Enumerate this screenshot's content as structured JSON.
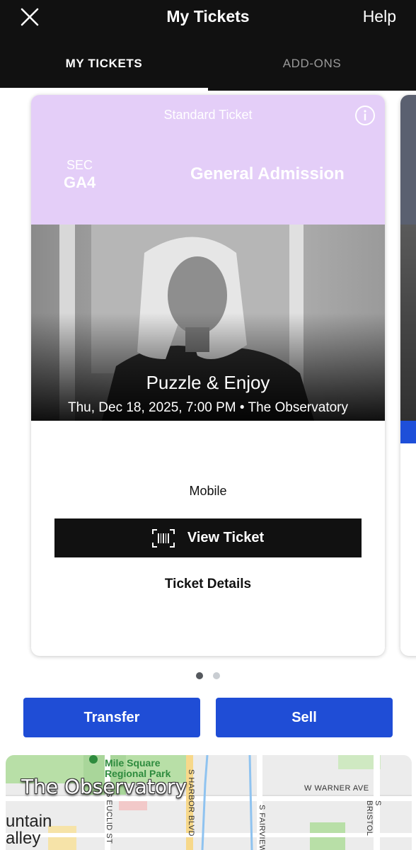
{
  "header": {
    "title": "My Tickets",
    "help_label": "Help"
  },
  "tabs": [
    {
      "label": "MY TICKETS",
      "active": true
    },
    {
      "label": "ADD-ONS",
      "active": false
    }
  ],
  "ticket": {
    "type_label": "Standard Ticket",
    "section_label": "SEC",
    "section_value": "GA4",
    "admission": "General Admission",
    "header_color": "#e4cef8",
    "event_name": "Puzzle & Enjoy",
    "event_datetime_venue": "Thu, Dec 18, 2025, 7:00 PM • The Observatory",
    "delivery_method": "Mobile",
    "view_ticket_label": "View Ticket",
    "details_label": "Ticket Details"
  },
  "pagination": {
    "current": 1,
    "total": 2
  },
  "actions": {
    "transfer_label": "Transfer",
    "sell_label": "Sell",
    "button_color": "#1f4dd6"
  },
  "map": {
    "venue_label": "The Observatory",
    "park_label_line1": "Mile Square",
    "park_label_line2": "Regional Park",
    "area_label_line1": "untain",
    "area_label_line2": "alley",
    "streets": {
      "warner": "W WARNER AVE",
      "harbor": "S HARBOR BLVD",
      "fairview": "S FAIRVIEW",
      "bristol": "S BRISTOL",
      "euclid": "S EUCLID ST"
    }
  },
  "icons": {
    "close": "close-icon",
    "info": "info-icon",
    "barcode": "barcode-icon"
  }
}
